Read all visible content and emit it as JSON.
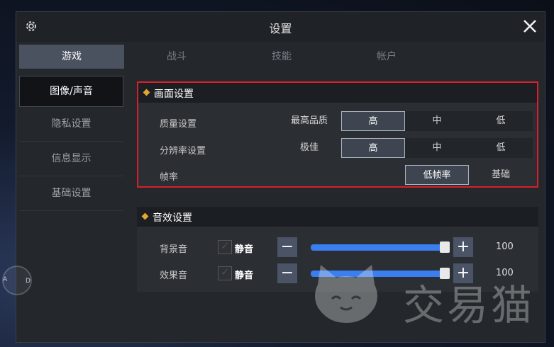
{
  "window": {
    "title": "设置"
  },
  "tabs": [
    "游戏",
    "战斗",
    "技能",
    "帐户"
  ],
  "sidebar": [
    "图像/声音",
    "隐私设置",
    "信息显示",
    "基础设置"
  ],
  "display": {
    "title": "画面设置",
    "quality": {
      "label": "质量设置",
      "options": [
        "最高品质",
        "高",
        "中",
        "低"
      ],
      "selected": "高"
    },
    "resolution": {
      "label": "分辨率设置",
      "options": [
        "极佳",
        "高",
        "中",
        "低"
      ],
      "selected": "高"
    },
    "framerate": {
      "label": "帧率",
      "options": [
        "低帧率",
        "基础"
      ],
      "selected": "低帧率"
    }
  },
  "sound": {
    "title": "音效设置",
    "bgm": {
      "label": "背景音",
      "mute_label": "静音",
      "value": "100"
    },
    "sfx": {
      "label": "效果音",
      "mute_label": "静音",
      "value": "100"
    }
  },
  "compass": {
    "west": "A",
    "east": "D"
  },
  "watermark": {
    "text": "交易猫"
  },
  "colors": {
    "accent": "#3a7ef0",
    "highlight_border": "#d8202a",
    "diamond": "#e0a830"
  }
}
